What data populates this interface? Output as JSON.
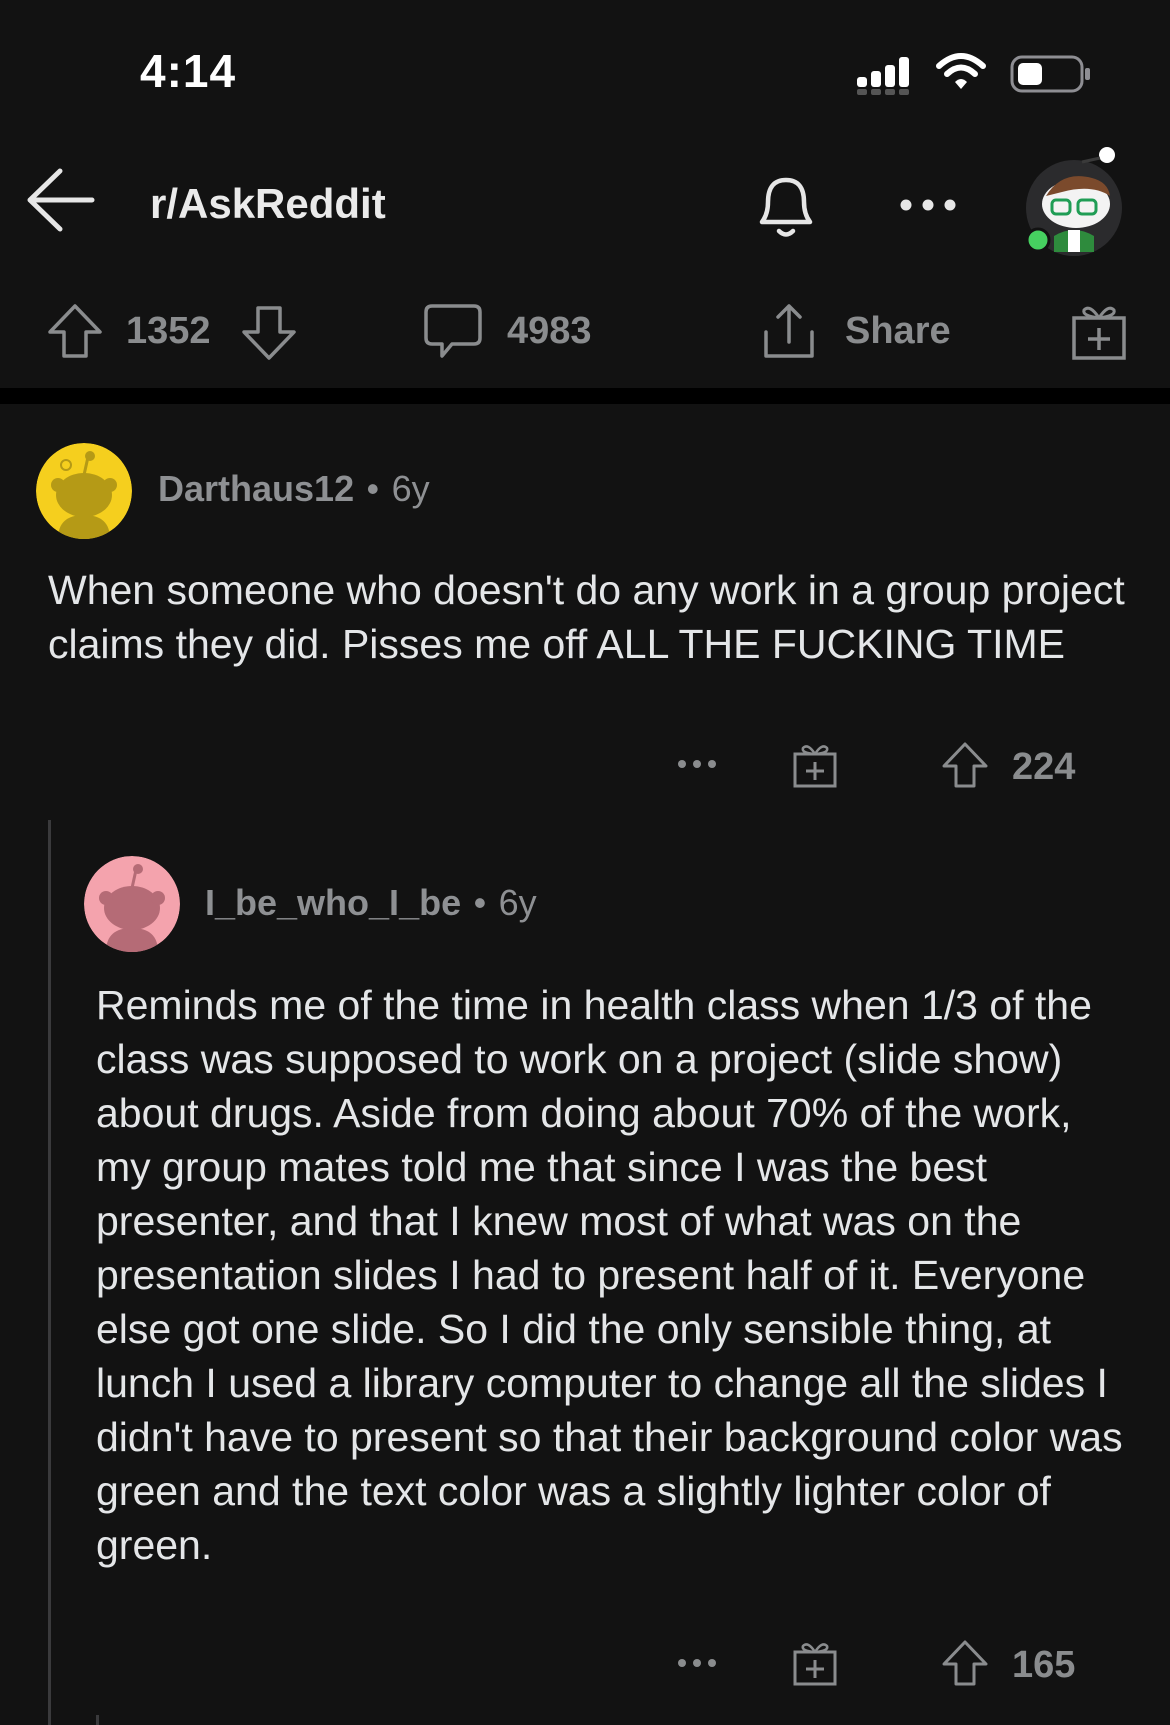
{
  "status_bar": {
    "time": "4:14"
  },
  "header": {
    "subreddit": "r/AskReddit",
    "icons": [
      "back-arrow-icon",
      "bell-icon",
      "more-icon",
      "user-avatar"
    ]
  },
  "post_actions": {
    "upvotes": "1352",
    "comments": "4983",
    "share_label": "Share"
  },
  "comments": [
    {
      "author": "Darthaus12",
      "age": "6y",
      "text": "When someone who doesn't do any work in a group project claims they did. Pisses me off ALL THE FUCKING TIME",
      "score": "224",
      "avatar_color": "#f5cf1e"
    },
    {
      "author": "I_be_who_I_be",
      "age": "6y",
      "text": "Reminds me of the time in health class when 1/3 of the class was supposed to work on a project (slide show) about drugs. Aside from doing about 70% of the work, my group mates told me that since I was the best presenter, and that I knew most of what was on the presentation slides I had to present half of it. Everyone else got one slide. So I did the only sensible thing, at lunch I used a library computer to change all the slides I didn't have to present so that their background color was green and the text color was a slightly lighter color of green.",
      "score": "165",
      "avatar_color": "#f4a3ad"
    }
  ],
  "separator": "•"
}
